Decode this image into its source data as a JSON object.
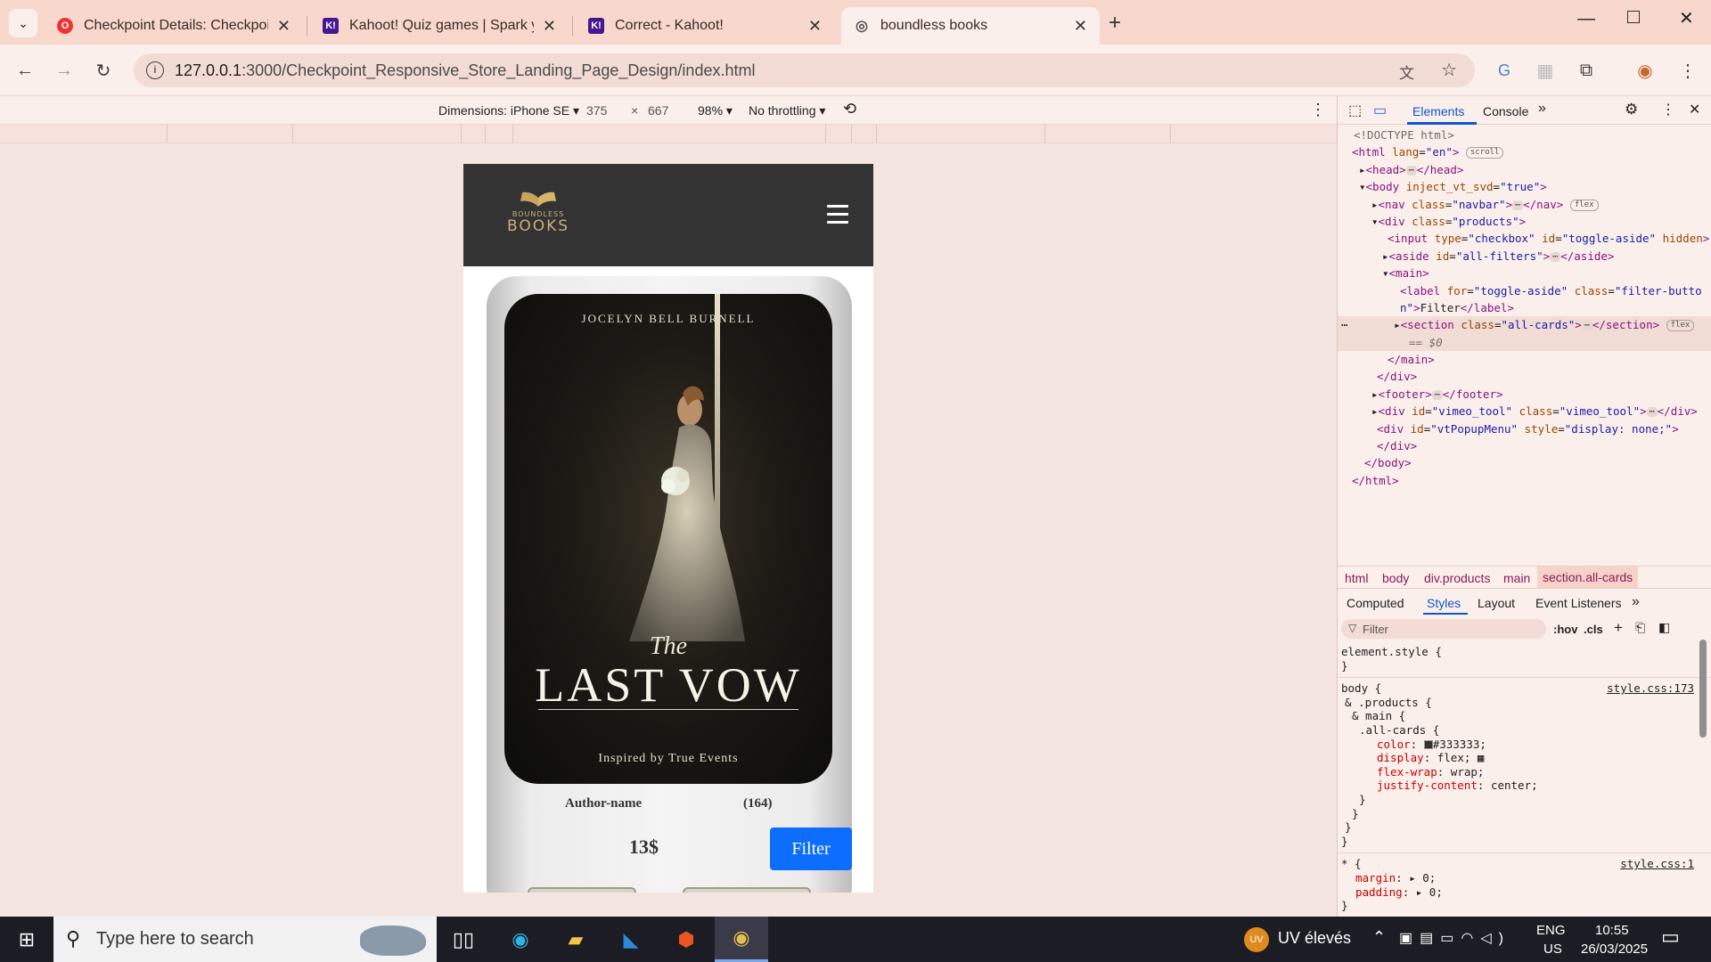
{
  "browser": {
    "tabs": [
      {
        "title": "Checkpoint Details: Checkpoint",
        "favicon": "red-o-icon",
        "color": "#e33"
      },
      {
        "title": "Kahoot! Quiz games | Spark you",
        "favicon": "kahoot-icon",
        "color": "#46178f"
      },
      {
        "title": "Correct - Kahoot!",
        "favicon": "kahoot-icon",
        "color": "#46178f"
      },
      {
        "title": "boundless books",
        "favicon": "globe-icon",
        "color": "#666"
      }
    ],
    "url_host": "127.0.0.1",
    "url_path": ":3000/Checkpoint_Responsive_Store_Landing_Page_Design/index.html"
  },
  "device_toolbar": {
    "dimensions": "Dimensions: iPhone SE",
    "width": "375",
    "times": "×",
    "height": "667",
    "zoom": "98%",
    "throttling": "No throttling"
  },
  "page": {
    "logo_top": "BOUNDLESS",
    "logo_bottom": "BOOKS",
    "cover_author": "JOCELYN BELL BURNELL",
    "cover_the": "The",
    "cover_title": "LAST VOW",
    "cover_subtitle": "Inspired by True Events",
    "author_label": "Author-name",
    "reviews": "(164)",
    "price": "13$",
    "filter_label": "Filter"
  },
  "devtools": {
    "tabs": {
      "elements": "Elements",
      "console": "Console",
      "more": "»"
    },
    "breadcrumbs": [
      "html",
      "body",
      "div.products",
      "main",
      "section.all-cards"
    ],
    "subtabs": [
      "Computed",
      "Styles",
      "Layout",
      "Event Listeners",
      "»"
    ],
    "filter_placeholder": "Filter",
    "hov": ":hov",
    "cls": ".cls",
    "tree": [
      "<!DOCTYPE html>"
    ],
    "element_style": "element.style {",
    "source1": "style.css:173",
    "source2": "style.css:1"
  },
  "taskbar": {
    "search_placeholder": "Type here to search",
    "weather": "UV élevés",
    "lang1": "ENG",
    "lang2": "US",
    "time": "10:55",
    "date": "26/03/2025"
  }
}
